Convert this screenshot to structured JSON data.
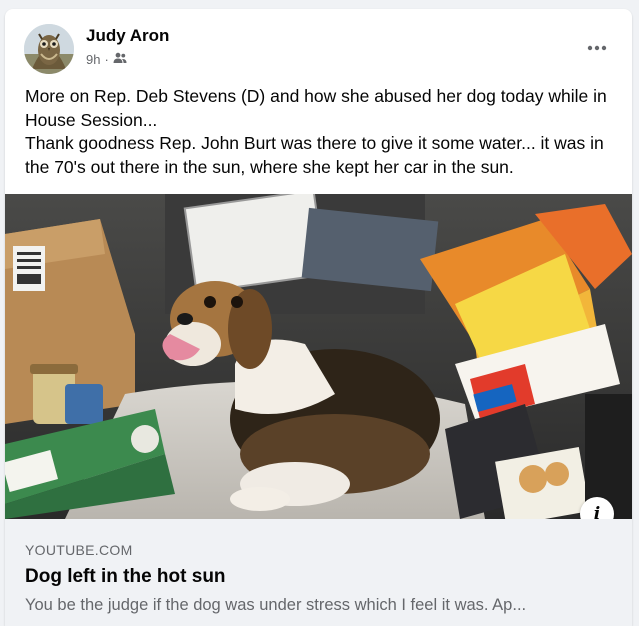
{
  "post": {
    "author": "Judy Aron",
    "time": "9h",
    "separator": "·",
    "audience_icon": "friends-icon",
    "more_icon": "more-options-icon",
    "text_line1": "More on Rep. Deb Stevens (D)  and how she abused her dog today while in House Session...",
    "text_line2": "Thank goodness Rep. John Burt was there to give it some water... it was in the 70's out there in the sun, where she kept her car in the sun."
  },
  "link_preview": {
    "domain": "YOUTUBE.COM",
    "title": "Dog left in the hot sun",
    "description": "You be the judge if the dog was under stress which I feel it was. Ap...",
    "info_label": "i"
  },
  "colors": {
    "background": "#f0f2f5",
    "text_primary": "#050505",
    "text_secondary": "#65676b"
  }
}
